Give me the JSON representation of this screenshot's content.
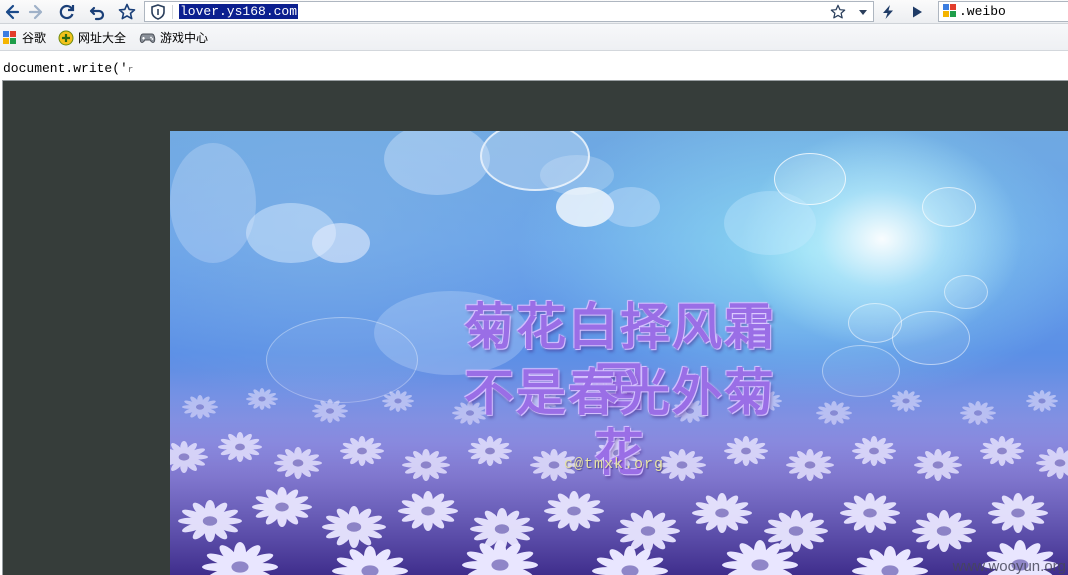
{
  "toolbar": {
    "url": "lover.ys168.com",
    "search_text": ".weibo"
  },
  "bookmarks": [
    {
      "label": "谷歌",
      "icon": "google-icon"
    },
    {
      "label": "网址大全",
      "icon": "sites-directory-icon"
    },
    {
      "label": "游戏中心",
      "icon": "gamepad-icon"
    }
  ],
  "page": {
    "code_text": "document.write('",
    "poem_line1": "菊花白择风霜国",
    "poem_line2": "不是春光外菊花",
    "credit": "c@tmxk.org",
    "watermark": "www.wooyun.org"
  },
  "colors": {
    "frame_bg": "#363d3a",
    "url_highlight": "#0b1f8f",
    "poem_text": "#9a6ee6",
    "credit_text": "#e6e2a4"
  }
}
